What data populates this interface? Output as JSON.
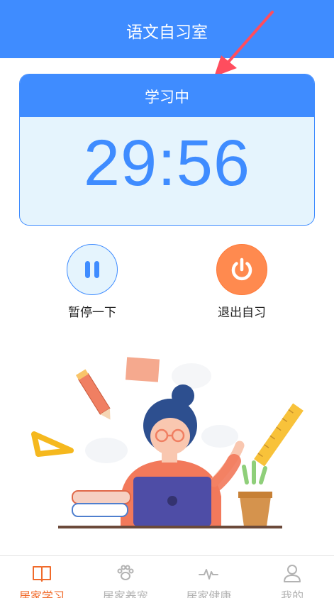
{
  "header": {
    "title": "语文自习室"
  },
  "timer": {
    "status": "学习中",
    "value": "29:56"
  },
  "actions": {
    "pause_label": "暂停一下",
    "exit_label": "退出自习"
  },
  "tabs": [
    {
      "label": "居家学习",
      "icon": "book-icon",
      "active": true
    },
    {
      "label": "居家养宠",
      "icon": "paw-icon",
      "active": false
    },
    {
      "label": "居家健康",
      "icon": "heartbeat-icon",
      "active": false
    },
    {
      "label": "我的",
      "icon": "user-icon",
      "active": false
    }
  ],
  "colors": {
    "primary": "#3f8cff",
    "accent_orange": "#ff8a4f",
    "active_tab": "#f06a2a",
    "inactive_tab": "#b3b3b3",
    "card_bg": "#e5f4fd"
  }
}
